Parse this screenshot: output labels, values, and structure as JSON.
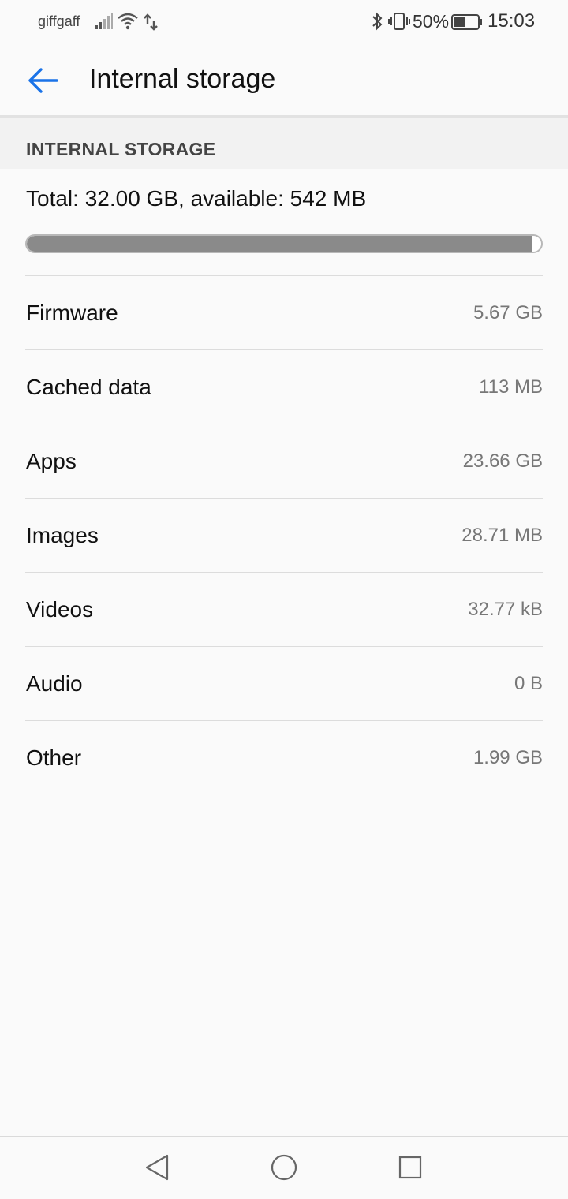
{
  "status_bar": {
    "carrier": "giffgaff",
    "battery_percent": "50%",
    "time": "15:03",
    "icons": [
      "signal-icon",
      "wifi-icon",
      "data-arrows-icon",
      "bluetooth-icon",
      "vibrate-icon",
      "battery-icon"
    ]
  },
  "app_bar": {
    "title": "Internal storage",
    "back_icon": "arrow-left-icon"
  },
  "section": {
    "label": "INTERNAL STORAGE"
  },
  "storage": {
    "summary": "Total: 32.00 GB, available: 542 MB",
    "used_fraction": 0.983
  },
  "items": [
    {
      "label": "Firmware",
      "value": "5.67 GB"
    },
    {
      "label": "Cached data",
      "value": "113 MB"
    },
    {
      "label": "Apps",
      "value": "23.66 GB"
    },
    {
      "label": "Images",
      "value": "28.71 MB"
    },
    {
      "label": "Videos",
      "value": "32.77 kB"
    },
    {
      "label": "Audio",
      "value": "0 B"
    },
    {
      "label": "Other",
      "value": "1.99 GB"
    }
  ],
  "colors": {
    "accent": "#1a73e8",
    "bar_fill": "#8a8a8a",
    "text_secondary": "#777777"
  },
  "nav_bar": {
    "icons": [
      "nav-back-icon",
      "nav-home-icon",
      "nav-recents-icon"
    ]
  }
}
